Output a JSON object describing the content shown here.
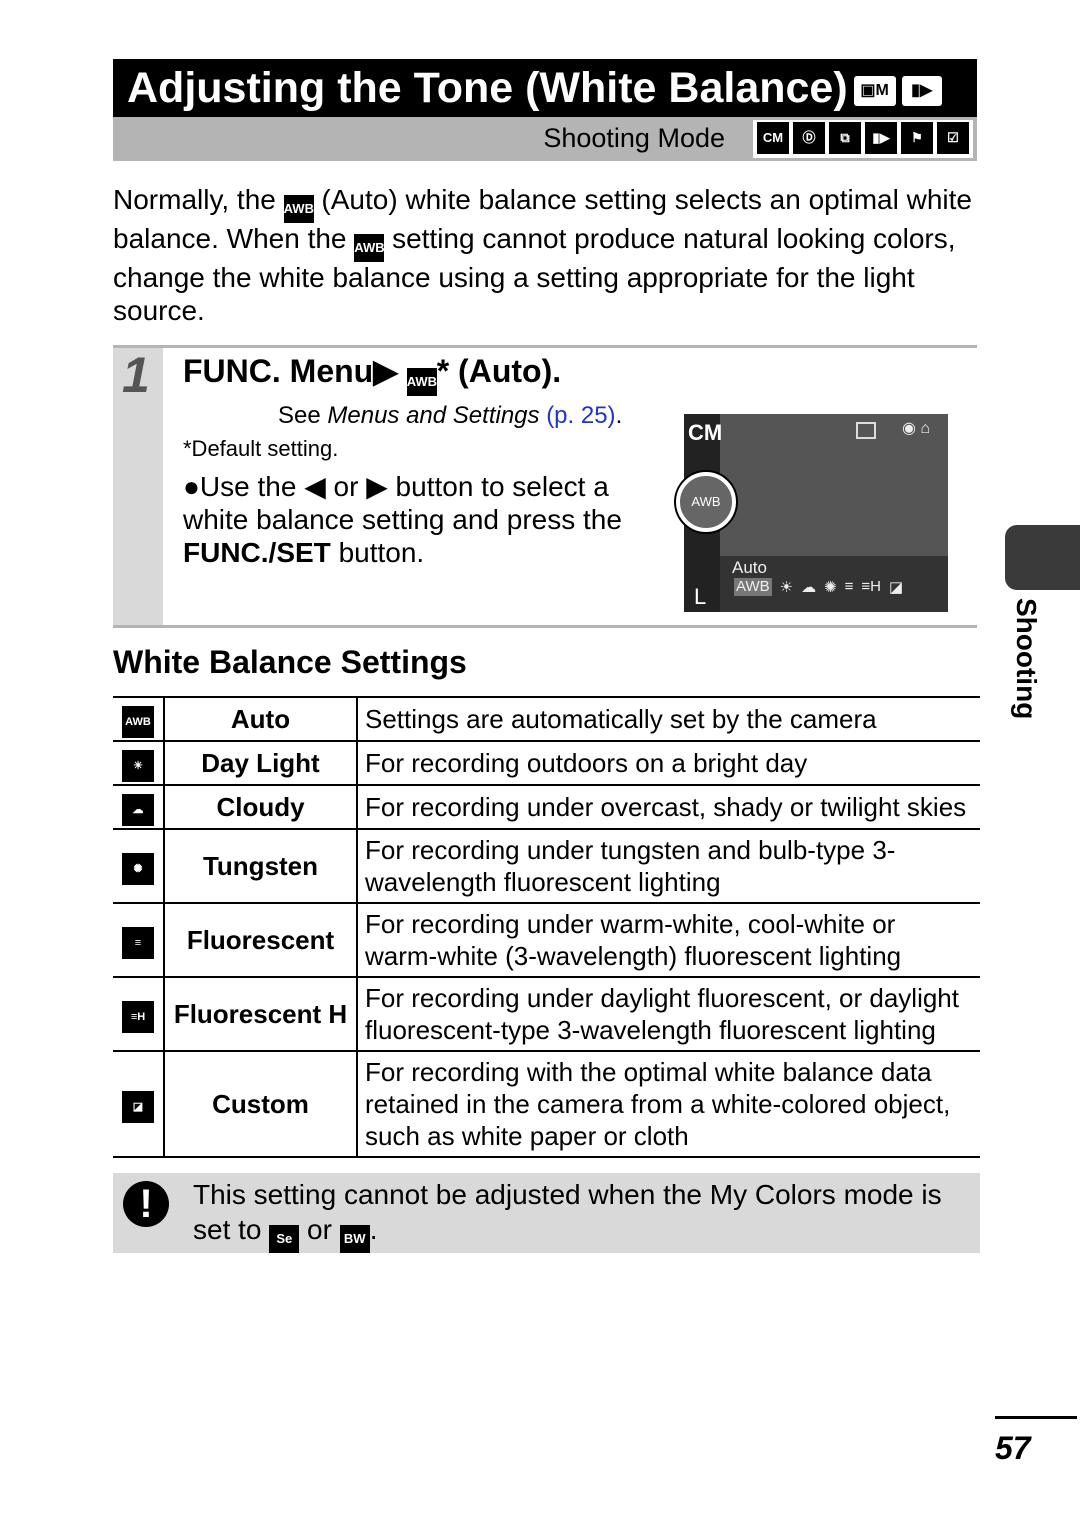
{
  "title": "Adjusting the Tone (White Balance)",
  "title_icons": [
    "camera-m-icon",
    "movie-icon"
  ],
  "shooting_mode": {
    "label": "Shooting Mode",
    "icons": [
      "CM",
      "SCN",
      "STITCH",
      "MOVIE",
      "SPORT",
      "MOVIE2"
    ]
  },
  "intro": {
    "p1": "Normally, the",
    "p2": "(Auto) white balance setting selects an optimal white balance. When the",
    "p3": "setting cannot produce natural looking colors, change the white balance using a setting appropriate for the light source.",
    "icon": "AWB"
  },
  "step": {
    "number": "1",
    "heading_a": "FUNC. Menu",
    "heading_b": "* (Auto).",
    "see_a": "See ",
    "see_italic": "Menus and Settings",
    "see_link": "(p. 25)",
    "see_end": ".",
    "default": "*Default setting.",
    "bullet_a": "Use the",
    "bullet_or": "or",
    "bullet_b": "button to select a white balance setting and press the",
    "bullet_bold": "FUNC./SET",
    "bullet_c": "button.",
    "screen": {
      "mode": "CM",
      "selected_label": "Auto",
      "wb": "AWB",
      "icons": [
        "AWB",
        "☀",
        "☁",
        "✺",
        "≡",
        "≡H",
        "◪"
      ]
    }
  },
  "section_title": "White Balance Settings",
  "table": [
    {
      "icon": "AWB",
      "name": "Auto",
      "desc": "Settings are automatically set by the camera"
    },
    {
      "icon": "☀",
      "name": "Day Light",
      "desc": "For recording outdoors on a bright day"
    },
    {
      "icon": "☁",
      "name": "Cloudy",
      "desc": "For recording under overcast, shady or twilight skies"
    },
    {
      "icon": "✺",
      "name": "Tungsten",
      "desc": "For recording under tungsten and bulb-type 3-wavelength fluorescent lighting"
    },
    {
      "icon": "≡",
      "name": "Fluorescent",
      "desc": "For recording under warm-white, cool-white or warm-white (3-wavelength) fluorescent lighting"
    },
    {
      "icon": "≡H",
      "name": "Fluorescent H",
      "desc": "For recording under daylight fluorescent, or daylight fluorescent-type 3-wavelength fluorescent lighting"
    },
    {
      "icon": "◪",
      "name": "Custom",
      "desc": "For recording with the optimal white balance data retained in the camera from a white-colored object, such as white paper or cloth"
    }
  ],
  "note": {
    "text_a": "This setting cannot be adjusted when the My Colors mode is set to",
    "icon1": "Se",
    "or": "or",
    "icon2": "BW",
    "end": "."
  },
  "side_tab": "Shooting",
  "page_number": "57"
}
